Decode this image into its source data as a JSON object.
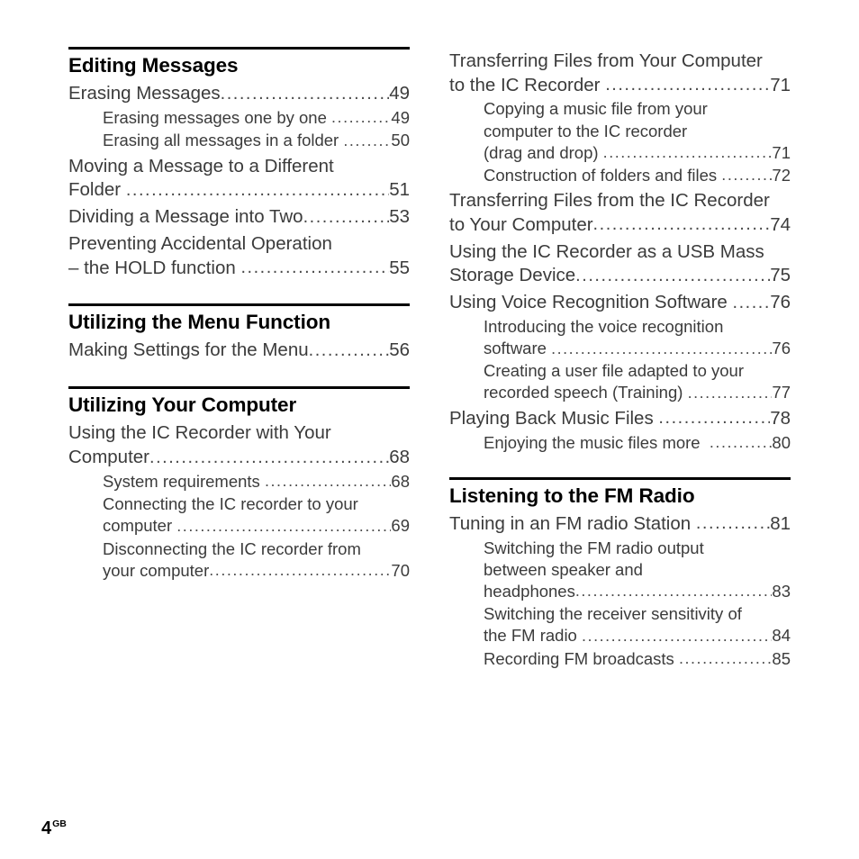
{
  "page": {
    "number": "4",
    "region_suffix": "GB"
  },
  "columns": [
    {
      "name": "left-column",
      "sections": [
        {
          "has_rule": true,
          "title": "Editing Messages",
          "entries": [
            {
              "level": 1,
              "lines": [
                "Erasing Messages"
              ],
              "page": "49"
            },
            {
              "level": 2,
              "lines": [
                "Erasing messages one by one "
              ],
              "page": "49"
            },
            {
              "level": 2,
              "lines": [
                "Erasing all messages in a folder "
              ],
              "page": "50"
            },
            {
              "level": 1,
              "lines": [
                "Moving a Message to a Different",
                "Folder "
              ],
              "page": "51"
            },
            {
              "level": 1,
              "lines": [
                "Dividing a Message into Two"
              ],
              "page": "53"
            },
            {
              "level": 1,
              "lines": [
                "Preventing Accidental Operation",
                "– the HOLD function "
              ],
              "page": "55"
            }
          ]
        },
        {
          "has_rule": true,
          "title": "Utilizing the Menu Function",
          "entries": [
            {
              "level": 1,
              "lines": [
                "Making Settings for the Menu"
              ],
              "page": "56"
            }
          ]
        },
        {
          "has_rule": true,
          "title": "Utilizing Your Computer",
          "entries": [
            {
              "level": 1,
              "lines": [
                "Using the IC Recorder with Your",
                "Computer"
              ],
              "page": "68"
            },
            {
              "level": 2,
              "lines": [
                "System requirements "
              ],
              "page": "68"
            },
            {
              "level": 2,
              "lines": [
                "Connecting the IC recorder to your",
                "computer "
              ],
              "page": "69"
            },
            {
              "level": 2,
              "lines": [
                "Disconnecting the IC recorder from",
                "your computer"
              ],
              "page": "70"
            }
          ]
        }
      ]
    },
    {
      "name": "right-column",
      "sections": [
        {
          "has_rule": false,
          "title": "",
          "entries": [
            {
              "level": 1,
              "lines": [
                "Transferring Files from Your Computer",
                "to the IC Recorder "
              ],
              "page": "71"
            },
            {
              "level": 2,
              "lines": [
                "Copying a music file from your",
                "computer to the IC recorder",
                "(drag and drop) "
              ],
              "page": "71"
            },
            {
              "level": 2,
              "lines": [
                "Construction of folders and files "
              ],
              "page": "72"
            },
            {
              "level": 1,
              "lines": [
                "Transferring Files from the IC Recorder",
                "to Your Computer"
              ],
              "page": "74"
            },
            {
              "level": 1,
              "lines": [
                "Using the IC Recorder as a USB Mass",
                "Storage Device"
              ],
              "page": "75"
            },
            {
              "level": 1,
              "lines": [
                "Using Voice Recognition Software "
              ],
              "page": "76"
            },
            {
              "level": 2,
              "lines": [
                "Introducing the voice recognition",
                "software "
              ],
              "page": "76"
            },
            {
              "level": 2,
              "lines": [
                "Creating a user file adapted to your",
                "recorded speech (Training) "
              ],
              "page": "77"
            },
            {
              "level": 1,
              "lines": [
                "Playing Back Music Files "
              ],
              "page": "78"
            },
            {
              "level": 2,
              "lines": [
                "Enjoying the music files more  "
              ],
              "page": "80"
            }
          ]
        },
        {
          "has_rule": true,
          "title": "Listening to the FM Radio",
          "entries": [
            {
              "level": 1,
              "lines": [
                "Tuning in an FM radio Station "
              ],
              "page": "81"
            },
            {
              "level": 2,
              "lines": [
                "Switching the FM radio output",
                "between speaker and",
                "headphones"
              ],
              "page": "83"
            },
            {
              "level": 2,
              "lines": [
                "Switching the receiver sensitivity of",
                "the FM radio "
              ],
              "page": "84"
            },
            {
              "level": 2,
              "lines": [
                "Recording FM broadcasts "
              ],
              "page": "85"
            }
          ]
        }
      ]
    }
  ]
}
